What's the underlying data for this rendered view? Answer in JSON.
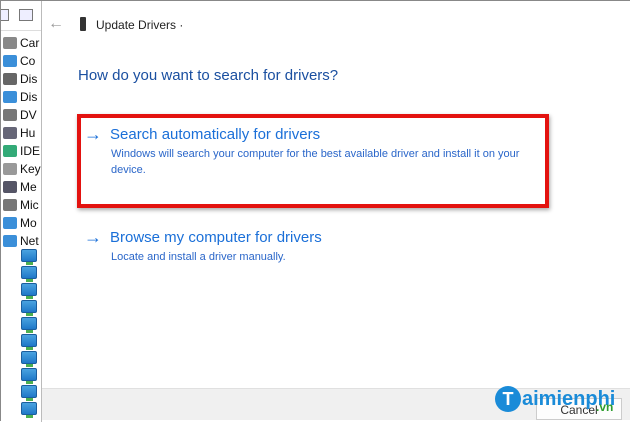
{
  "device_tree": {
    "categories": [
      "Car",
      "Co",
      "Dis",
      "Dis",
      "DV",
      "Hu",
      "IDE",
      "Key",
      "Me",
      "Mic",
      "Mo",
      "Net"
    ],
    "network_children_count": 10
  },
  "dialog": {
    "title": "Update Drivers ·",
    "question": "How do you want to search for drivers?",
    "options": [
      {
        "label": "Search automatically for drivers",
        "description": "Windows will search your computer for the best available driver and install it on your device.",
        "highlighted": true
      },
      {
        "label": "Browse my computer for drivers",
        "description": "Locate and install a driver manually."
      }
    ],
    "cancel_label": "Cancel"
  },
  "watermark": {
    "text": "Taimienphi",
    ".vn": ".vn"
  },
  "colors": {
    "accent": "#1a6fd8",
    "highlight": "#e3120f"
  }
}
